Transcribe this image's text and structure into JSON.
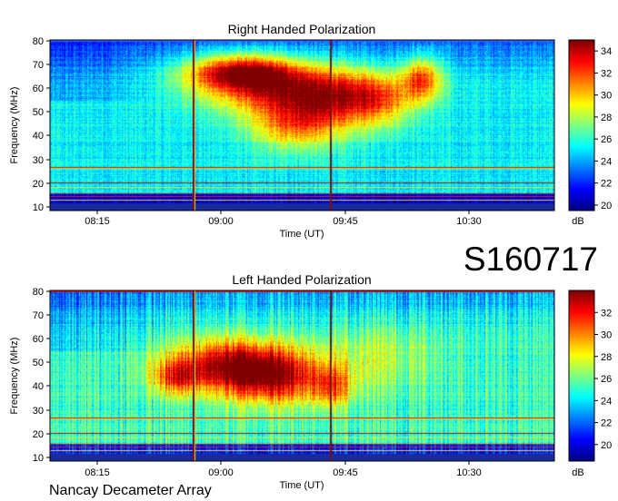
{
  "chart_data": [
    {
      "type": "heatmap",
      "title": "Right Handed Polarization",
      "xlabel": "Time (UT)",
      "ylabel": "Frequency (MHz)",
      "xticks": [
        "08:15",
        "09:00",
        "09:45",
        "10:30"
      ],
      "xtick_values_min": [
        495,
        540,
        585,
        630
      ],
      "xlim_min": [
        479,
        681
      ],
      "yticks": [
        10,
        20,
        30,
        40,
        50,
        60,
        70,
        80
      ],
      "ylim": [
        10,
        80
      ],
      "colorbar": {
        "label": "dB",
        "ticks": [
          20,
          22,
          24,
          26,
          28,
          30,
          32,
          34
        ],
        "range": [
          19.5,
          35
        ]
      },
      "emission_blobs": [
        {
          "t_min": 555,
          "f_mhz": 67,
          "dt": 22,
          "df": 7,
          "db": 33
        },
        {
          "t_min": 570,
          "f_mhz": 60,
          "dt": 30,
          "df": 11,
          "db": 32
        },
        {
          "t_min": 578,
          "f_mhz": 45,
          "dt": 18,
          "df": 10,
          "db": 30.5
        },
        {
          "t_min": 598,
          "f_mhz": 56,
          "dt": 22,
          "df": 11,
          "db": 30.5
        },
        {
          "t_min": 628,
          "f_mhz": 64,
          "dt": 8,
          "df": 9,
          "db": 31.5
        },
        {
          "t_min": 612,
          "f_mhz": 55,
          "dt": 12,
          "df": 12,
          "db": 28
        }
      ]
    },
    {
      "type": "heatmap",
      "title": "Left Handed Polarization",
      "xlabel": "Time (UT)",
      "ylabel": "Frequency (MHz)",
      "xticks": [
        "08:15",
        "09:00",
        "09:45",
        "10:30"
      ],
      "xtick_values_min": [
        495,
        540,
        585,
        630
      ],
      "xlim_min": [
        479,
        681
      ],
      "yticks": [
        10,
        20,
        30,
        40,
        50,
        60,
        70,
        80
      ],
      "ylim": [
        10,
        80
      ],
      "colorbar": {
        "label": "dB",
        "ticks": [
          20,
          22,
          24,
          26,
          28,
          30,
          32
        ],
        "range": [
          18.5,
          34
        ]
      },
      "emission_blobs": [
        {
          "t_min": 550,
          "f_mhz": 50,
          "dt": 25,
          "df": 10,
          "db": 32
        },
        {
          "t_min": 568,
          "f_mhz": 44,
          "dt": 22,
          "df": 11,
          "db": 32
        },
        {
          "t_min": 530,
          "f_mhz": 44,
          "dt": 10,
          "df": 7,
          "db": 29.5
        },
        {
          "t_min": 592,
          "f_mhz": 40,
          "dt": 8,
          "df": 8,
          "db": 29
        },
        {
          "t_min": 610,
          "f_mhz": 52,
          "dt": 25,
          "df": 12,
          "db": 27
        }
      ]
    }
  ],
  "burst_id": "S160717",
  "instrument": "Nancay Decameter Array"
}
